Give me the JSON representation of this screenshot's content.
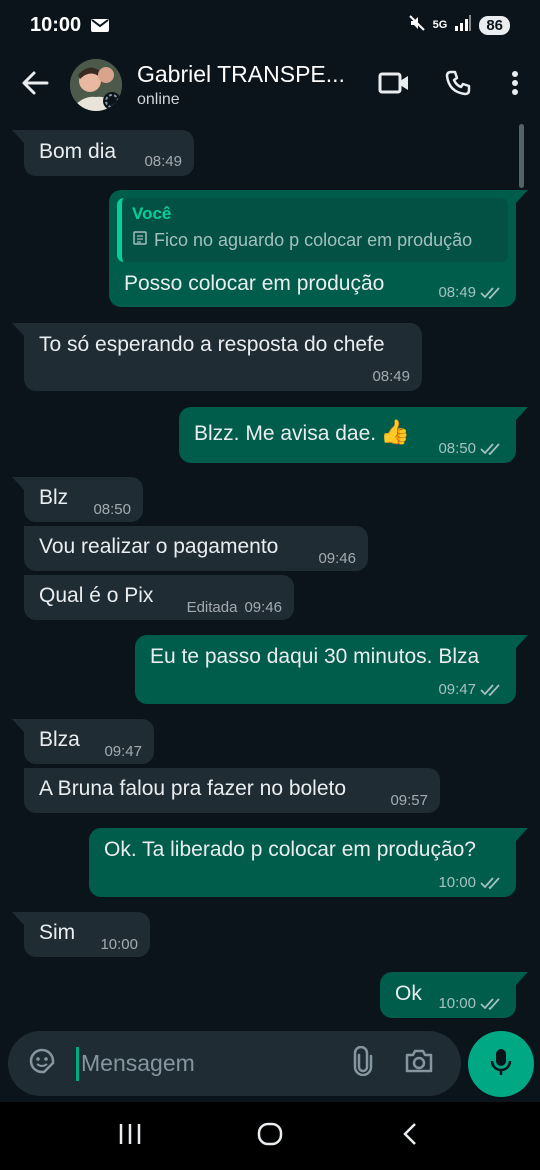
{
  "status_bar": {
    "time": "10:00",
    "network": "5G",
    "battery": "86"
  },
  "header": {
    "contact_name": "Gabriel TRANSPE...",
    "contact_status": "online"
  },
  "messages": [
    {
      "dir": "in",
      "text": "Bom dia",
      "time": "08:49"
    },
    {
      "dir": "out",
      "quote_author": "Você",
      "quote_text": "Fico no aguardo p colocar em produção",
      "text": "Posso colocar em  produção",
      "time": "08:49",
      "status": "read"
    },
    {
      "dir": "in",
      "text": "To só esperando a resposta do chefe",
      "time": "08:49"
    },
    {
      "dir": "out",
      "text": "Blzz. Me avisa dae.",
      "emoji": "👍",
      "time": "08:50",
      "status": "read"
    },
    {
      "dir": "in",
      "text": "Blz",
      "time": "08:50"
    },
    {
      "dir": "in",
      "text": "Vou realizar o pagamento",
      "time": "09:46"
    },
    {
      "dir": "in",
      "text": "Qual é o Pix",
      "edited": "Editada",
      "time": "09:46"
    },
    {
      "dir": "out",
      "text": "Eu te passo daqui 30 minutos. Blza",
      "time": "09:47",
      "status": "read"
    },
    {
      "dir": "in",
      "text": "Blza",
      "time": "09:47"
    },
    {
      "dir": "in",
      "text": "A Bruna falou pra fazer no boleto",
      "time": "09:57"
    },
    {
      "dir": "out",
      "text": "Ok. Ta liberado p colocar em produção?",
      "time": "10:00",
      "status": "read"
    },
    {
      "dir": "in",
      "text": "Sim",
      "time": "10:00"
    },
    {
      "dir": "out",
      "text": "Ok",
      "time": "10:00",
      "status": "read"
    }
  ],
  "composer": {
    "placeholder": "Mensagem"
  },
  "icons": {
    "back": "arrow-left-icon",
    "video": "video-call-icon",
    "voice": "phone-icon",
    "menu": "more-vertical-icon",
    "sticker": "sticker-icon",
    "attach": "paperclip-icon",
    "camera": "camera-icon",
    "mic": "microphone-icon"
  },
  "colors": {
    "background": "#0b141a",
    "incoming_bubble": "#1f2c34",
    "outgoing_bubble": "#005c4b",
    "accent": "#00a884",
    "quote_accent": "#06cf9c"
  }
}
